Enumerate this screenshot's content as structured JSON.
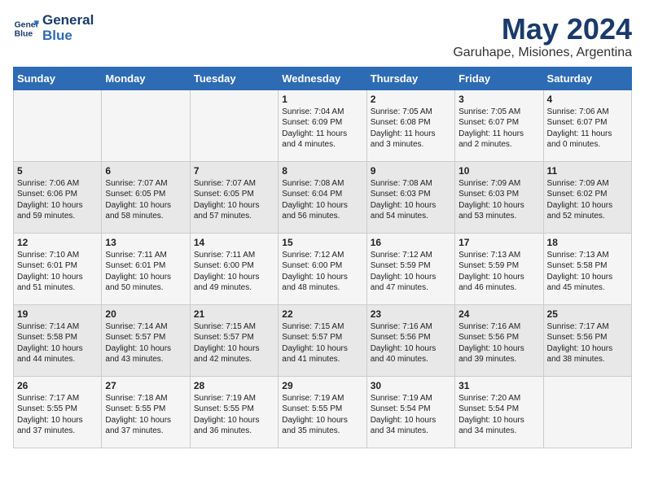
{
  "logo": {
    "line1": "General",
    "line2": "Blue"
  },
  "title": "May 2024",
  "location": "Garuhape, Misiones, Argentina",
  "weekdays": [
    "Sunday",
    "Monday",
    "Tuesday",
    "Wednesday",
    "Thursday",
    "Friday",
    "Saturday"
  ],
  "weeks": [
    [
      {
        "day": "",
        "text": ""
      },
      {
        "day": "",
        "text": ""
      },
      {
        "day": "",
        "text": ""
      },
      {
        "day": "1",
        "text": "Sunrise: 7:04 AM\nSunset: 6:09 PM\nDaylight: 11 hours\nand 4 minutes."
      },
      {
        "day": "2",
        "text": "Sunrise: 7:05 AM\nSunset: 6:08 PM\nDaylight: 11 hours\nand 3 minutes."
      },
      {
        "day": "3",
        "text": "Sunrise: 7:05 AM\nSunset: 6:07 PM\nDaylight: 11 hours\nand 2 minutes."
      },
      {
        "day": "4",
        "text": "Sunrise: 7:06 AM\nSunset: 6:07 PM\nDaylight: 11 hours\nand 0 minutes."
      }
    ],
    [
      {
        "day": "5",
        "text": "Sunrise: 7:06 AM\nSunset: 6:06 PM\nDaylight: 10 hours\nand 59 minutes."
      },
      {
        "day": "6",
        "text": "Sunrise: 7:07 AM\nSunset: 6:05 PM\nDaylight: 10 hours\nand 58 minutes."
      },
      {
        "day": "7",
        "text": "Sunrise: 7:07 AM\nSunset: 6:05 PM\nDaylight: 10 hours\nand 57 minutes."
      },
      {
        "day": "8",
        "text": "Sunrise: 7:08 AM\nSunset: 6:04 PM\nDaylight: 10 hours\nand 56 minutes."
      },
      {
        "day": "9",
        "text": "Sunrise: 7:08 AM\nSunset: 6:03 PM\nDaylight: 10 hours\nand 54 minutes."
      },
      {
        "day": "10",
        "text": "Sunrise: 7:09 AM\nSunset: 6:03 PM\nDaylight: 10 hours\nand 53 minutes."
      },
      {
        "day": "11",
        "text": "Sunrise: 7:09 AM\nSunset: 6:02 PM\nDaylight: 10 hours\nand 52 minutes."
      }
    ],
    [
      {
        "day": "12",
        "text": "Sunrise: 7:10 AM\nSunset: 6:01 PM\nDaylight: 10 hours\nand 51 minutes."
      },
      {
        "day": "13",
        "text": "Sunrise: 7:11 AM\nSunset: 6:01 PM\nDaylight: 10 hours\nand 50 minutes."
      },
      {
        "day": "14",
        "text": "Sunrise: 7:11 AM\nSunset: 6:00 PM\nDaylight: 10 hours\nand 49 minutes."
      },
      {
        "day": "15",
        "text": "Sunrise: 7:12 AM\nSunset: 6:00 PM\nDaylight: 10 hours\nand 48 minutes."
      },
      {
        "day": "16",
        "text": "Sunrise: 7:12 AM\nSunset: 5:59 PM\nDaylight: 10 hours\nand 47 minutes."
      },
      {
        "day": "17",
        "text": "Sunrise: 7:13 AM\nSunset: 5:59 PM\nDaylight: 10 hours\nand 46 minutes."
      },
      {
        "day": "18",
        "text": "Sunrise: 7:13 AM\nSunset: 5:58 PM\nDaylight: 10 hours\nand 45 minutes."
      }
    ],
    [
      {
        "day": "19",
        "text": "Sunrise: 7:14 AM\nSunset: 5:58 PM\nDaylight: 10 hours\nand 44 minutes."
      },
      {
        "day": "20",
        "text": "Sunrise: 7:14 AM\nSunset: 5:57 PM\nDaylight: 10 hours\nand 43 minutes."
      },
      {
        "day": "21",
        "text": "Sunrise: 7:15 AM\nSunset: 5:57 PM\nDaylight: 10 hours\nand 42 minutes."
      },
      {
        "day": "22",
        "text": "Sunrise: 7:15 AM\nSunset: 5:57 PM\nDaylight: 10 hours\nand 41 minutes."
      },
      {
        "day": "23",
        "text": "Sunrise: 7:16 AM\nSunset: 5:56 PM\nDaylight: 10 hours\nand 40 minutes."
      },
      {
        "day": "24",
        "text": "Sunrise: 7:16 AM\nSunset: 5:56 PM\nDaylight: 10 hours\nand 39 minutes."
      },
      {
        "day": "25",
        "text": "Sunrise: 7:17 AM\nSunset: 5:56 PM\nDaylight: 10 hours\nand 38 minutes."
      }
    ],
    [
      {
        "day": "26",
        "text": "Sunrise: 7:17 AM\nSunset: 5:55 PM\nDaylight: 10 hours\nand 37 minutes."
      },
      {
        "day": "27",
        "text": "Sunrise: 7:18 AM\nSunset: 5:55 PM\nDaylight: 10 hours\nand 37 minutes."
      },
      {
        "day": "28",
        "text": "Sunrise: 7:19 AM\nSunset: 5:55 PM\nDaylight: 10 hours\nand 36 minutes."
      },
      {
        "day": "29",
        "text": "Sunrise: 7:19 AM\nSunset: 5:55 PM\nDaylight: 10 hours\nand 35 minutes."
      },
      {
        "day": "30",
        "text": "Sunrise: 7:19 AM\nSunset: 5:54 PM\nDaylight: 10 hours\nand 34 minutes."
      },
      {
        "day": "31",
        "text": "Sunrise: 7:20 AM\nSunset: 5:54 PM\nDaylight: 10 hours\nand 34 minutes."
      },
      {
        "day": "",
        "text": ""
      }
    ]
  ]
}
